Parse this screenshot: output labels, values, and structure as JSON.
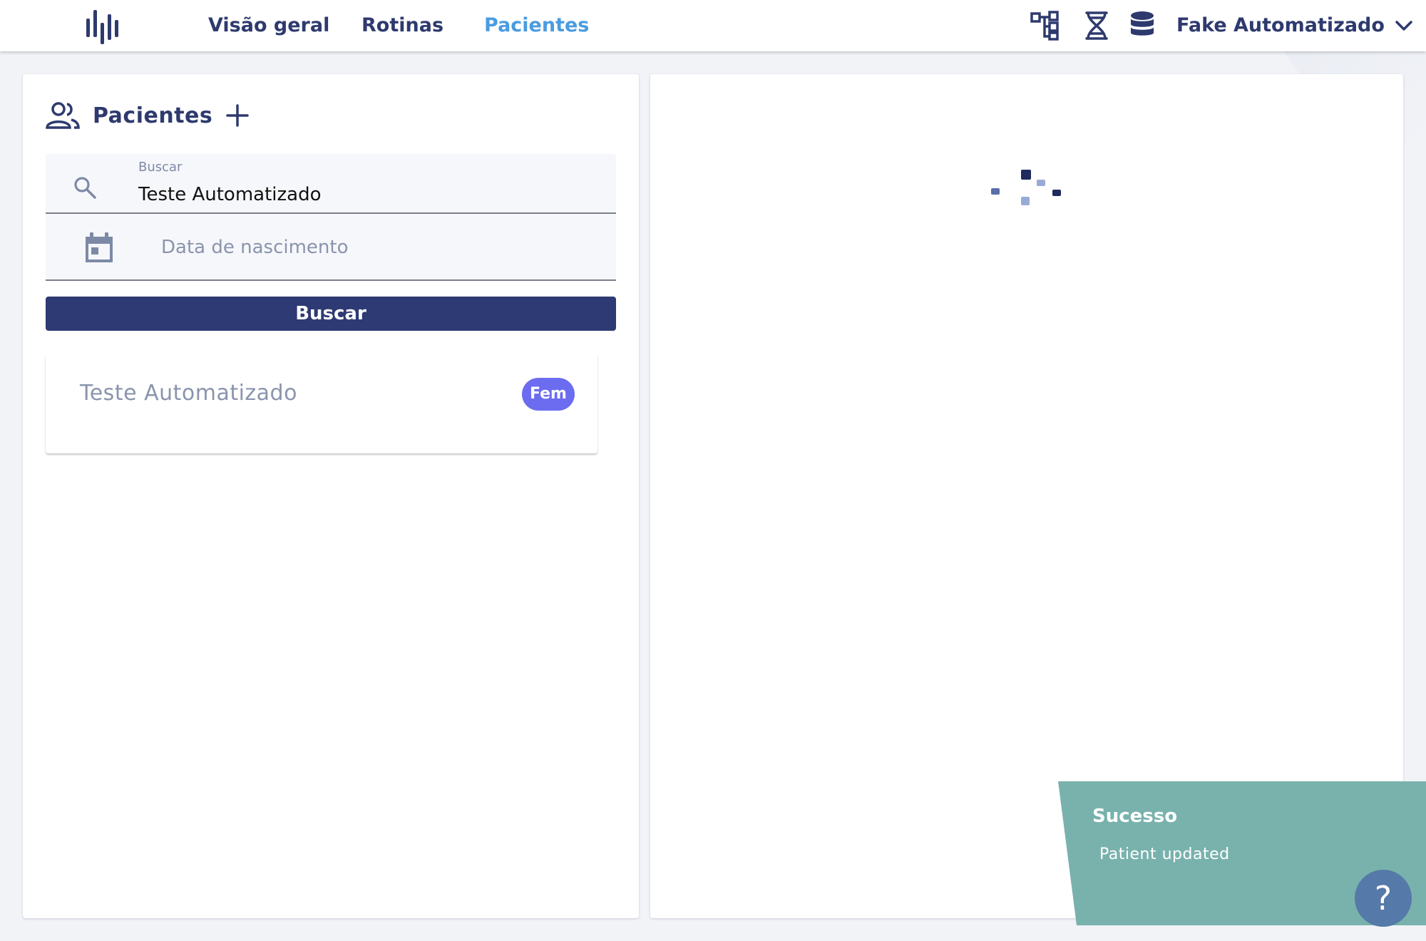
{
  "nav": {
    "items": [
      {
        "label": "Visão geral"
      },
      {
        "label": "Rotinas"
      },
      {
        "label": "Pacientes"
      }
    ],
    "user_name": "Fake Automatizado",
    "icons": [
      "hierarchy-icon",
      "dna-icon",
      "database-icon",
      "chevron-down-icon"
    ]
  },
  "patients_panel": {
    "title": "Pacientes",
    "search": {
      "label": "Buscar",
      "value": "Teste Automatizado"
    },
    "birthdate": {
      "placeholder": "Data de nascimento"
    },
    "search_button": "Buscar",
    "results": [
      {
        "name": "Teste Automatizado",
        "sex": "Fem"
      }
    ]
  },
  "toast": {
    "title": "Sucesso",
    "message": "Patient updated"
  },
  "help": {
    "label": "?"
  },
  "colors": {
    "primary": "#2e3a73",
    "nav_active": "#4a9ce0",
    "badge": "#6c6cf0",
    "toast": "#79b2ad",
    "help": "#5579a8"
  }
}
